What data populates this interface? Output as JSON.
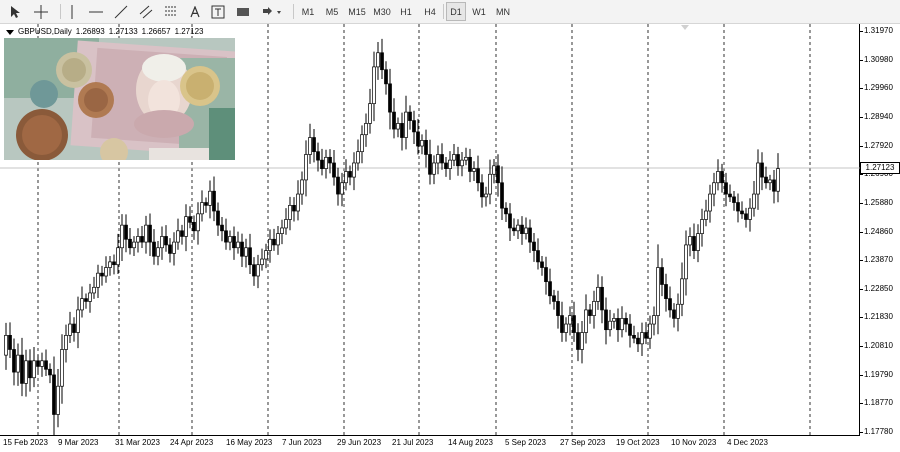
{
  "toolbar": {
    "timeframes": [
      "M1",
      "M5",
      "M15",
      "M30",
      "H1",
      "H4",
      "D1",
      "W1",
      "MN"
    ],
    "active_timeframe": "D1"
  },
  "info": {
    "symbol": "GBPUSD,Daily",
    "open": "1.26893",
    "high": "1.27133",
    "low": "1.26657",
    "close": "1.27123"
  },
  "current_price": "1.27123",
  "chart_data": {
    "type": "candlestick",
    "symbol": "GBPUSD",
    "timeframe": "Daily",
    "y_ticks": [
      "1.31970",
      "1.30980",
      "1.29960",
      "1.28940",
      "1.27920",
      "1.26900",
      "1.25880",
      "1.24860",
      "1.23870",
      "1.22850",
      "1.21830",
      "1.20810",
      "1.19790",
      "1.18770",
      "1.17780"
    ],
    "x_ticks": [
      "15 Feb 2023",
      "9 Mar 2023",
      "31 Mar 2023",
      "24 Apr 2023",
      "16 May 2023",
      "7 Jun 2023",
      "29 Jun 2023",
      "21 Jul 2023",
      "14 Aug 2023",
      "5 Sep 2023",
      "27 Sep 2023",
      "19 Oct 2023",
      "10 Nov 2023",
      "4 Dec 2023"
    ],
    "ylim": [
      1.1778,
      1.3197
    ],
    "grid": "vertical dashed",
    "close_path": [
      [
        0,
        1.205
      ],
      [
        4,
        1.212
      ],
      [
        8,
        1.207
      ],
      [
        12,
        1.199
      ],
      [
        16,
        1.205
      ],
      [
        20,
        1.195
      ],
      [
        24,
        1.203
      ],
      [
        28,
        1.197
      ],
      [
        32,
        1.203
      ],
      [
        36,
        1.201
      ],
      [
        40,
        1.203
      ],
      [
        44,
        1.2
      ],
      [
        48,
        1.198
      ],
      [
        52,
        1.184
      ],
      [
        56,
        1.194
      ],
      [
        60,
        1.207
      ],
      [
        64,
        1.212
      ],
      [
        68,
        1.216
      ],
      [
        72,
        1.213
      ],
      [
        76,
        1.221
      ],
      [
        80,
        1.225
      ],
      [
        84,
        1.224
      ],
      [
        88,
        1.227
      ],
      [
        92,
        1.229
      ],
      [
        96,
        1.234
      ],
      [
        100,
        1.233
      ],
      [
        104,
        1.236
      ],
      [
        108,
        1.238
      ],
      [
        112,
        1.237
      ],
      [
        116,
        1.243
      ],
      [
        120,
        1.251
      ],
      [
        124,
        1.246
      ],
      [
        128,
        1.243
      ],
      [
        132,
        1.245
      ],
      [
        136,
        1.247
      ],
      [
        140,
        1.245
      ],
      [
        144,
        1.251
      ],
      [
        148,
        1.245
      ],
      [
        152,
        1.24
      ],
      [
        156,
        1.243
      ],
      [
        160,
        1.247
      ],
      [
        164,
        1.244
      ],
      [
        168,
        1.241
      ],
      [
        172,
        1.245
      ],
      [
        176,
        1.249
      ],
      [
        180,
        1.247
      ],
      [
        184,
        1.254
      ],
      [
        188,
        1.252
      ],
      [
        192,
        1.249
      ],
      [
        196,
        1.255
      ],
      [
        200,
        1.259
      ],
      [
        204,
        1.258
      ],
      [
        208,
        1.263
      ],
      [
        212,
        1.256
      ],
      [
        216,
        1.251
      ],
      [
        220,
        1.249
      ],
      [
        224,
        1.245
      ],
      [
        228,
        1.247
      ],
      [
        232,
        1.243
      ],
      [
        236,
        1.245
      ],
      [
        240,
        1.24
      ],
      [
        244,
        1.243
      ],
      [
        248,
        1.237
      ],
      [
        252,
        1.233
      ],
      [
        256,
        1.237
      ],
      [
        260,
        1.239
      ],
      [
        264,
        1.242
      ],
      [
        268,
        1.246
      ],
      [
        272,
        1.244
      ],
      [
        276,
        1.248
      ],
      [
        280,
        1.25
      ],
      [
        284,
        1.253
      ],
      [
        288,
        1.258
      ],
      [
        292,
        1.256
      ],
      [
        296,
        1.262
      ],
      [
        300,
        1.267
      ],
      [
        304,
        1.276
      ],
      [
        308,
        1.282
      ],
      [
        312,
        1.277
      ],
      [
        316,
        1.274
      ],
      [
        320,
        1.271
      ],
      [
        324,
        1.275
      ],
      [
        328,
        1.273
      ],
      [
        332,
        1.268
      ],
      [
        336,
        1.262
      ],
      [
        340,
        1.266
      ],
      [
        344,
        1.27
      ],
      [
        348,
        1.268
      ],
      [
        352,
        1.273
      ],
      [
        356,
        1.277
      ],
      [
        360,
        1.283
      ],
      [
        364,
        1.287
      ],
      [
        368,
        1.294
      ],
      [
        372,
        1.307
      ],
      [
        376,
        1.312
      ],
      [
        380,
        1.306
      ],
      [
        384,
        1.301
      ],
      [
        388,
        1.291
      ],
      [
        392,
        1.285
      ],
      [
        396,
        1.287
      ],
      [
        400,
        1.282
      ],
      [
        404,
        1.291
      ],
      [
        408,
        1.288
      ],
      [
        412,
        1.284
      ],
      [
        416,
        1.279
      ],
      [
        420,
        1.281
      ],
      [
        424,
        1.276
      ],
      [
        428,
        1.269
      ],
      [
        432,
        1.273
      ],
      [
        436,
        1.276
      ],
      [
        440,
        1.273
      ],
      [
        444,
        1.271
      ],
      [
        448,
        1.274
      ],
      [
        452,
        1.276
      ],
      [
        456,
        1.272
      ],
      [
        460,
        1.274
      ],
      [
        464,
        1.275
      ],
      [
        468,
        1.27
      ],
      [
        472,
        1.271
      ],
      [
        476,
        1.266
      ],
      [
        480,
        1.261
      ],
      [
        484,
        1.262
      ],
      [
        488,
        1.269
      ],
      [
        492,
        1.272
      ],
      [
        496,
        1.266
      ],
      [
        500,
        1.257
      ],
      [
        504,
        1.255
      ],
      [
        508,
        1.25
      ],
      [
        512,
        1.249
      ],
      [
        516,
        1.251
      ],
      [
        520,
        1.248
      ],
      [
        524,
        1.25
      ],
      [
        528,
        1.245
      ],
      [
        532,
        1.242
      ],
      [
        536,
        1.238
      ],
      [
        540,
        1.236
      ],
      [
        544,
        1.231
      ],
      [
        548,
        1.226
      ],
      [
        552,
        1.224
      ],
      [
        556,
        1.219
      ],
      [
        560,
        1.213
      ],
      [
        564,
        1.216
      ],
      [
        568,
        1.219
      ],
      [
        572,
        1.213
      ],
      [
        576,
        1.207
      ],
      [
        580,
        1.213
      ],
      [
        584,
        1.221
      ],
      [
        588,
        1.219
      ],
      [
        592,
        1.224
      ],
      [
        596,
        1.229
      ],
      [
        600,
        1.221
      ],
      [
        604,
        1.214
      ],
      [
        608,
        1.217
      ],
      [
        612,
        1.218
      ],
      [
        616,
        1.214
      ],
      [
        620,
        1.218
      ],
      [
        624,
        1.216
      ],
      [
        628,
        1.212
      ],
      [
        632,
        1.211
      ],
      [
        636,
        1.209
      ],
      [
        640,
        1.213
      ],
      [
        644,
        1.211
      ],
      [
        648,
        1.216
      ],
      [
        652,
        1.219
      ],
      [
        656,
        1.236
      ],
      [
        660,
        1.23
      ],
      [
        664,
        1.225
      ],
      [
        668,
        1.221
      ],
      [
        672,
        1.218
      ],
      [
        676,
        1.223
      ],
      [
        680,
        1.232
      ],
      [
        684,
        1.244
      ],
      [
        688,
        1.247
      ],
      [
        692,
        1.242
      ],
      [
        696,
        1.248
      ],
      [
        700,
        1.253
      ],
      [
        704,
        1.256
      ],
      [
        708,
        1.262
      ],
      [
        712,
        1.266
      ],
      [
        716,
        1.27
      ],
      [
        720,
        1.266
      ],
      [
        724,
        1.262
      ],
      [
        728,
        1.261
      ],
      [
        732,
        1.259
      ],
      [
        736,
        1.256
      ],
      [
        740,
        1.255
      ],
      [
        744,
        1.253
      ],
      [
        748,
        1.257
      ],
      [
        752,
        1.262
      ],
      [
        756,
        1.273
      ],
      [
        760,
        1.268
      ],
      [
        764,
        1.266
      ],
      [
        768,
        1.267
      ],
      [
        772,
        1.263
      ],
      [
        776,
        1.271
      ]
    ]
  }
}
